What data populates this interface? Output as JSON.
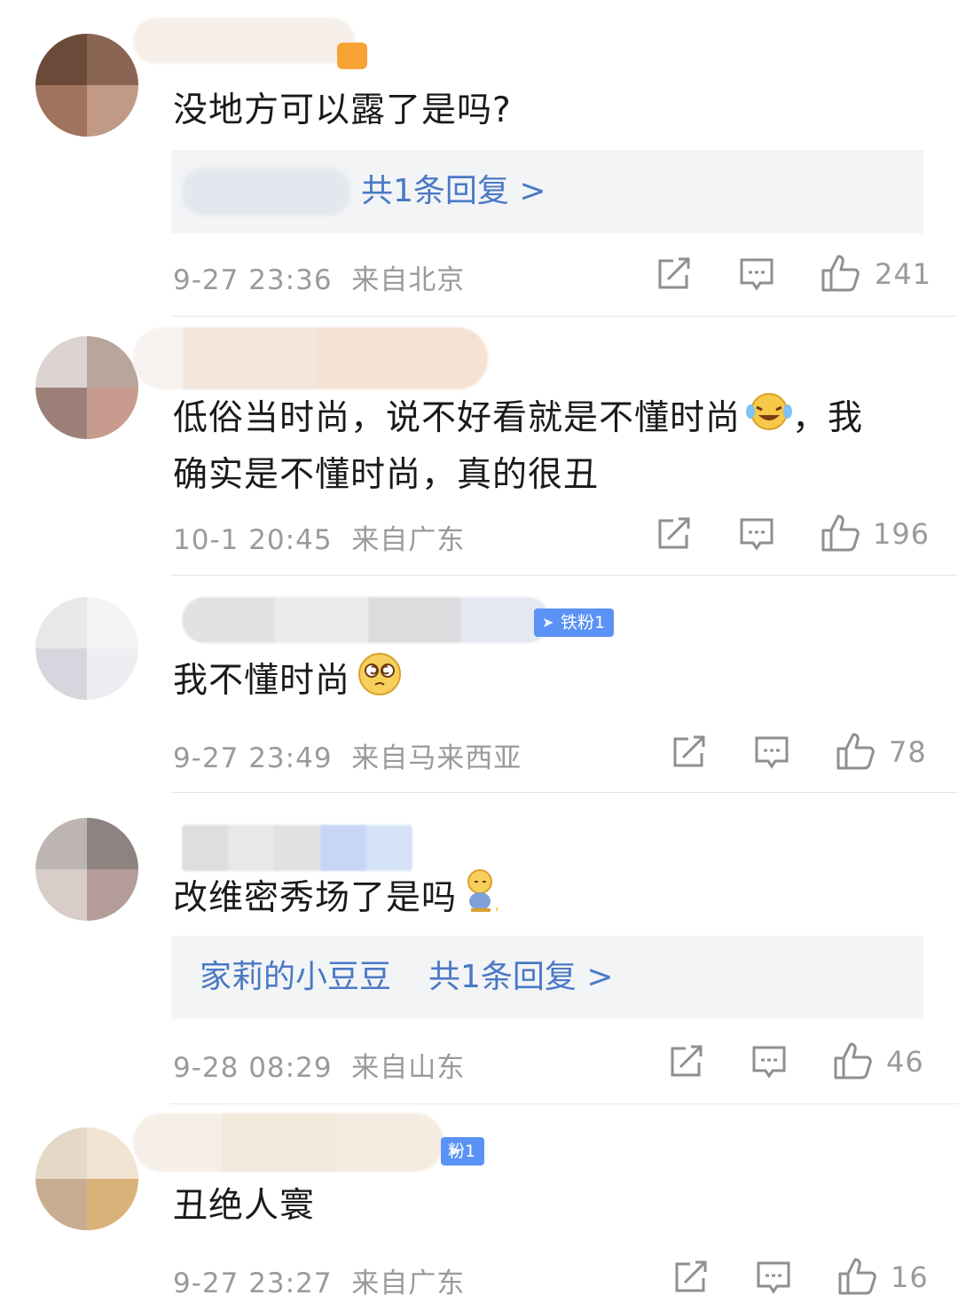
{
  "comments": [
    {
      "text": "没地方可以露了是吗?",
      "reply": {
        "author": "",
        "label": "共1条回复 >"
      },
      "time": "9-27 23:36",
      "location": "来自北京",
      "likes": "241"
    },
    {
      "text_line1": "低俗当时尚，说不好看就是不懂时尚",
      "text_tail": "，我",
      "text_line2": "确实是不懂时尚，真的很丑",
      "time": "10-1 20:45",
      "location": "来自广东",
      "likes": "196"
    },
    {
      "badge": "铁粉1",
      "text": "我不懂时尚",
      "time": "9-27 23:49",
      "location": "来自马来西亚",
      "likes": "78"
    },
    {
      "text": "改维密秀场了是吗",
      "reply": {
        "author": "家莉的小豆豆",
        "label": "共1条回复 >"
      },
      "time": "9-28 08:29",
      "location": "来自山东",
      "likes": "46"
    },
    {
      "badge": "粉1",
      "text": "丑绝人寰",
      "time": "9-27 23:27",
      "location": "来自广东",
      "likes": "16"
    }
  ],
  "icons": {
    "repost": "repost-icon",
    "comment": "comment-icon",
    "like": "thumbs-up-icon",
    "emoji_cry_laugh": "crying-laughing-emoji",
    "emoji_dizzy": "dizzy-face-emoji",
    "emoji_shy": "shy-sitting-emoji"
  },
  "colors": {
    "link": "#4a79c5",
    "meta": "#9a9a9a",
    "badge": "#5a93f5",
    "reply_bg": "#f3f4f6"
  }
}
